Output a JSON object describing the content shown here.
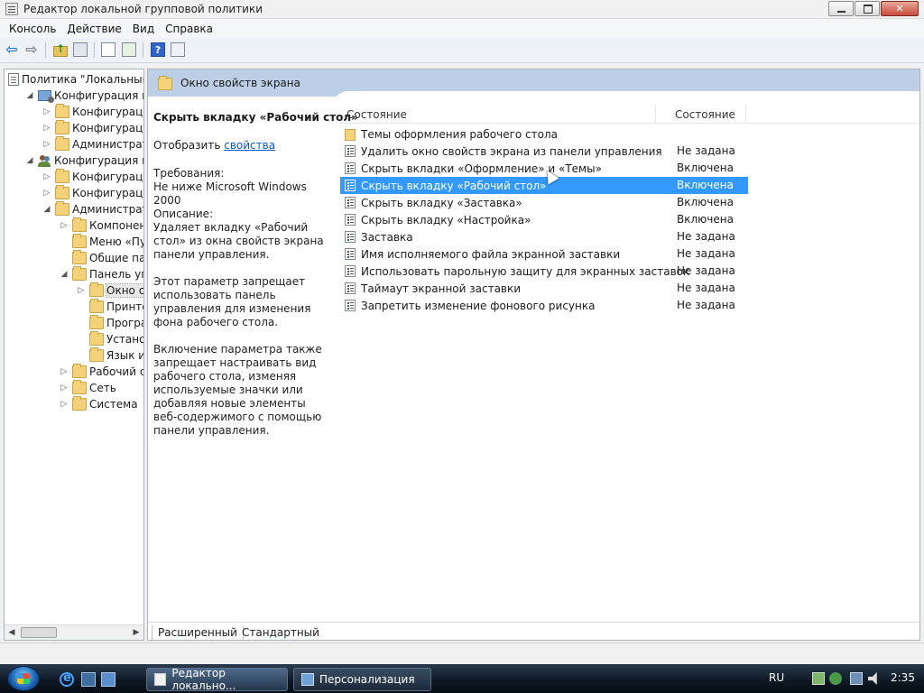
{
  "window": {
    "title": "Редактор локальной групповой политики"
  },
  "menu": [
    "Консоль",
    "Действие",
    "Вид",
    "Справка"
  ],
  "tree": {
    "items": [
      {
        "label": "Политика \"Локальный",
        "level": 0,
        "icon": "document-icon",
        "toggle": ""
      },
      {
        "label": "Конфигурация комп",
        "level": 1,
        "icon": "computer-icon",
        "toggle": "expanded"
      },
      {
        "label": "Конфигурация п",
        "level": 2,
        "icon": "folder-icon",
        "toggle": "collapsed"
      },
      {
        "label": "Конфигурация W",
        "level": 2,
        "icon": "folder-icon",
        "toggle": "collapsed"
      },
      {
        "label": "Административн",
        "level": 2,
        "icon": "folder-icon",
        "toggle": "collapsed"
      },
      {
        "label": "Конфигурация поль",
        "level": 1,
        "icon": "users-icon",
        "toggle": "expanded"
      },
      {
        "label": "Конфигурация п",
        "level": 2,
        "icon": "folder-icon",
        "toggle": "collapsed"
      },
      {
        "label": "Конфигурация W",
        "level": 2,
        "icon": "folder-icon",
        "toggle": "collapsed"
      },
      {
        "label": "Административн",
        "level": 2,
        "icon": "folder-icon",
        "toggle": "expanded"
      },
      {
        "label": "Компоненты",
        "level": 3,
        "icon": "folder-icon",
        "toggle": "collapsed"
      },
      {
        "label": "Меню «Пуск",
        "level": 3,
        "icon": "folder-icon",
        "toggle": ""
      },
      {
        "label": "Общие папки",
        "level": 3,
        "icon": "folder-icon",
        "toggle": ""
      },
      {
        "label": "Панель упра",
        "level": 3,
        "icon": "folder-icon",
        "toggle": "expanded"
      },
      {
        "label": "Окно сво",
        "level": 4,
        "icon": "folder-icon",
        "toggle": "collapsed",
        "selected": true
      },
      {
        "label": "Принтеры",
        "level": 4,
        "icon": "folder-icon",
        "toggle": ""
      },
      {
        "label": "Программ",
        "level": 4,
        "icon": "folder-icon",
        "toggle": ""
      },
      {
        "label": "Установка",
        "level": 4,
        "icon": "folder-icon",
        "toggle": ""
      },
      {
        "label": "Язык и ре",
        "level": 4,
        "icon": "folder-icon",
        "toggle": ""
      },
      {
        "label": "Рабочий сто",
        "level": 3,
        "icon": "folder-icon",
        "toggle": "collapsed"
      },
      {
        "label": "Сеть",
        "level": 3,
        "icon": "folder-icon",
        "toggle": "collapsed"
      },
      {
        "label": "Система",
        "level": 3,
        "icon": "folder-icon",
        "toggle": "collapsed"
      }
    ]
  },
  "right": {
    "header_title": "Окно свойств экрана",
    "description": {
      "title": "Скрыть вкладку «Рабочий стол»",
      "show_prefix": "Отобразить ",
      "show_link": "свойства",
      "requirements_label": "Требования:",
      "requirements_value": "Не ниже Microsoft Windows 2000",
      "description_label": "Описание:",
      "description_text": "Удаляет вкладку «Рабочий стол» из окна свойств экрана панели управления.",
      "para2": "Этот параметр запрещает использовать панель управления для изменения фона рабочего стола.",
      "para3": "Включение параметра также запрещает настраивать вид рабочего стола, изменяя используемые значки или добавляя новые элементы веб-содержимого с помощью панели управления."
    },
    "columns": [
      "Состояние",
      "Состояние"
    ],
    "rows": [
      {
        "name": "Темы оформления рабочего стола",
        "state": "",
        "type": "folder"
      },
      {
        "name": "Удалить окно свойств экрана из панели управления",
        "state": "Не задана",
        "type": "setting"
      },
      {
        "name": "Скрыть вкладки «Оформление» и «Темы»",
        "state": "Включена",
        "type": "setting"
      },
      {
        "name": "Скрыть вкладку «Рабочий стол»",
        "state": "Включена",
        "type": "setting",
        "selected": true
      },
      {
        "name": "Скрыть вкладку «Заставка»",
        "state": "Включена",
        "type": "setting"
      },
      {
        "name": "Скрыть вкладку «Настройка»",
        "state": "Включена",
        "type": "setting"
      },
      {
        "name": "Заставка",
        "state": "Не задана",
        "type": "setting"
      },
      {
        "name": "Имя исполняемого файла экранной заставки",
        "state": "Не задана",
        "type": "setting"
      },
      {
        "name": "Использовать парольную защиту для экранных заставок",
        "state": "Не задана",
        "type": "setting"
      },
      {
        "name": "Таймаут экранной заставки",
        "state": "Не задана",
        "type": "setting"
      },
      {
        "name": "Запретить изменение фонового рисунка",
        "state": "Не задана",
        "type": "setting"
      }
    ],
    "tabs": [
      "Расширенный",
      "Стандартный"
    ]
  },
  "taskbar": {
    "buttons": [
      "Редактор локально...",
      "Персонализация"
    ],
    "lang": "RU",
    "time": "2:35"
  }
}
